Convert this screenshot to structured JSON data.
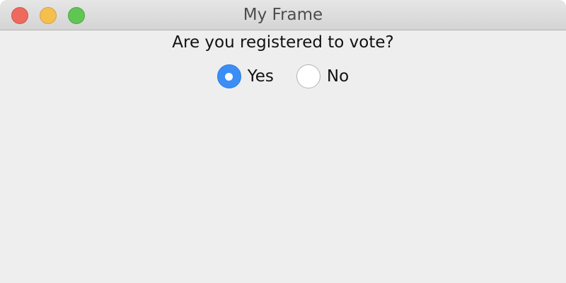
{
  "window": {
    "title": "My Frame"
  },
  "form": {
    "question": "Are you registered to vote?",
    "options": [
      {
        "label": "Yes",
        "selected": true
      },
      {
        "label": "No",
        "selected": false
      }
    ]
  },
  "colors": {
    "accent": "#3b8ef5",
    "close": "#ee6a5f",
    "minimize": "#f5bf4f",
    "zoom": "#61c554",
    "background": "#eeeeee"
  }
}
